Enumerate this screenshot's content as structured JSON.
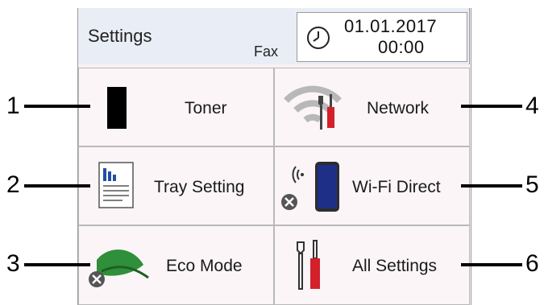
{
  "header": {
    "title": "Settings",
    "mode": "Fax",
    "date": "01.01.2017",
    "time": "00:00"
  },
  "tiles": [
    {
      "label": "Toner",
      "icon": "toner-cartridge-icon",
      "callout": "1"
    },
    {
      "label": "Network",
      "icon": "network-settings-icon",
      "callout": "4"
    },
    {
      "label": "Tray Setting",
      "icon": "tray-paper-icon",
      "callout": "2"
    },
    {
      "label": "Wi-Fi Direct",
      "icon": "wifi-direct-phone-icon",
      "callout": "5"
    },
    {
      "label": "Eco Mode",
      "icon": "eco-leaf-icon",
      "callout": "3"
    },
    {
      "label": "All Settings",
      "icon": "tools-icon",
      "callout": "6"
    }
  ],
  "colors": {
    "header_bg": "#e9edf5",
    "tile_bg": "#fbf5f7",
    "accent_red": "#d3202a",
    "leaf_green": "#2f8f3a"
  }
}
